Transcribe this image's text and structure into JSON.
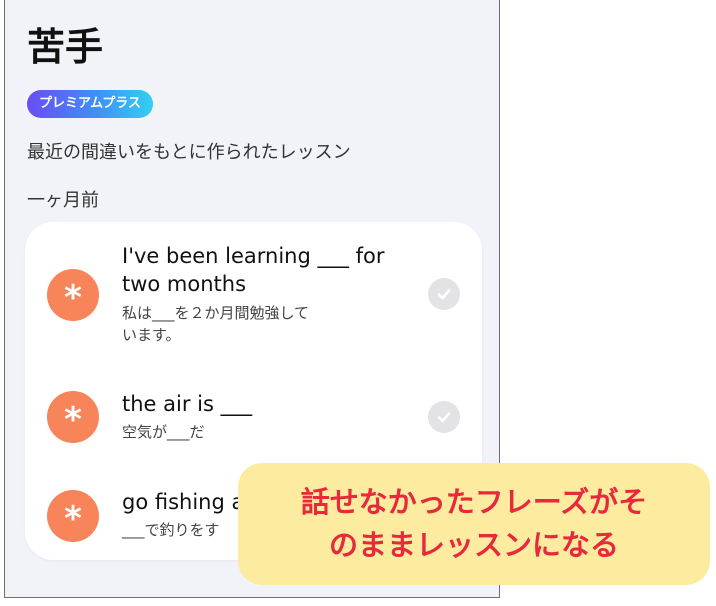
{
  "screen": {
    "title": "苦手",
    "badge": "プレミアムプラス",
    "subtitle": "最近の間違いをもとに作られたレッスン",
    "section_label": "一ヶ月前"
  },
  "lessons": [
    {
      "icon": "asterisk-icon",
      "phrase_line1": "I've been learning ___ for",
      "phrase_line2": "two months",
      "translation_line1": "私は___を２か月間勉強して",
      "translation_line2": "います。",
      "completed": true
    },
    {
      "icon": "asterisk-icon",
      "phrase_line1": "the air is ___",
      "translation_line1": "空気が___だ",
      "completed": true
    },
    {
      "icon": "asterisk-icon",
      "phrase_line1": "go fishing a",
      "translation_line1": "___で釣りをす",
      "completed": false
    }
  ],
  "callout": {
    "line1": "話せなかったフレーズがそ",
    "line2": "のままレッスンになる"
  },
  "colors": {
    "accent_orange": "#f8845a",
    "callout_bg": "#fdeba0",
    "callout_text": "#e8293b",
    "badge_gradient": [
      "#6a4cf5",
      "#3f8ff6",
      "#33d0f0"
    ]
  }
}
